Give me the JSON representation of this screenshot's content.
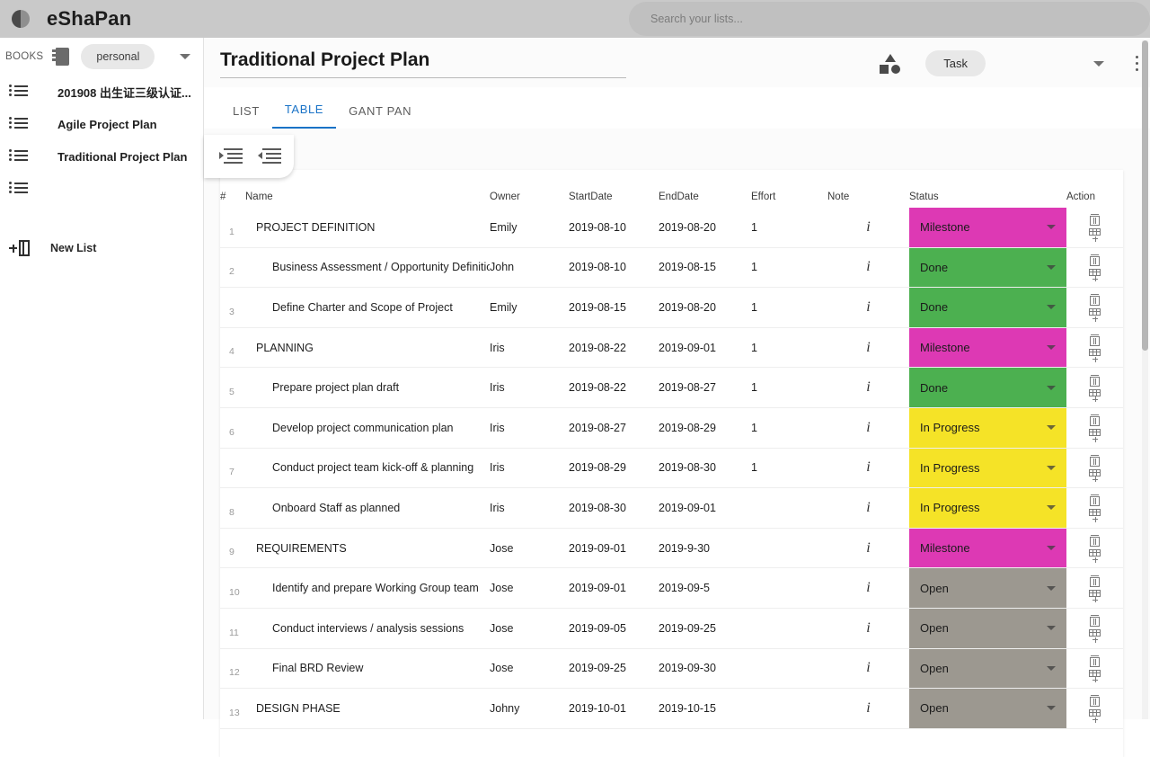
{
  "app": {
    "brand": "eShaPan",
    "logo_icon": "split-circle-icon"
  },
  "search": {
    "placeholder": "Search your lists...",
    "value": ""
  },
  "sidebar": {
    "section_label": "BOOKS",
    "book_icon": "notebook-icon",
    "book_chip": "personal",
    "book_caret": "chevron-down-icon",
    "items": [
      {
        "label": "201908 出生证三级认证...",
        "icon": "list-icon"
      },
      {
        "label": "Agile Project Plan",
        "icon": "list-icon"
      },
      {
        "label": "Traditional Project Plan",
        "icon": "list-icon"
      },
      {
        "label": "",
        "icon": "list-icon"
      }
    ],
    "new_list": {
      "label": "New List",
      "icon": "add-list-icon"
    }
  },
  "header": {
    "title": "Traditional Project Plan",
    "shapes_icon": "shapes-icon",
    "task_chip": "Task",
    "caret_icon": "chevron-down-icon",
    "menu_icon": "more-vertical-icon"
  },
  "tabs": [
    {
      "label": "LIST",
      "active": false
    },
    {
      "label": "TABLE",
      "active": true
    },
    {
      "label": "GANT PAN",
      "active": false
    }
  ],
  "indent_toolbar": {
    "increase": "indent-increase-icon",
    "decrease": "indent-decrease-icon"
  },
  "table": {
    "columns": {
      "num": "#",
      "name": "Name",
      "owner": "Owner",
      "startdate": "StartDate",
      "enddate": "EndDate",
      "effort": "Effort",
      "note": "Note",
      "status": "Status",
      "action": "Action"
    },
    "status_colors": {
      "Milestone": "#DD39B4",
      "Done": "#4CB050",
      "In Progress": "#F5E327",
      "Open": "#9C9890"
    },
    "rows": [
      {
        "num": "1",
        "name": "PROJECT DEFINITION",
        "level": 0,
        "owner": "Emily",
        "start": "2019-08-10",
        "end": "2019-08-20",
        "effort": "1",
        "note": "i",
        "status": "Milestone"
      },
      {
        "num": "2",
        "name": "Business Assessment / Opportunity Definition",
        "level": 1,
        "owner": "John",
        "start": "2019-08-10",
        "end": "2019-08-15",
        "effort": "1",
        "note": "i",
        "status": "Done"
      },
      {
        "num": "3",
        "name": "Define Charter and Scope of Project",
        "level": 1,
        "owner": "Emily",
        "start": "2019-08-15",
        "end": "2019-08-20",
        "effort": "1",
        "note": "i",
        "status": "Done"
      },
      {
        "num": "4",
        "name": "PLANNING",
        "level": 0,
        "owner": "Iris",
        "start": "2019-08-22",
        "end": "2019-09-01",
        "effort": "1",
        "note": "i",
        "status": "Milestone"
      },
      {
        "num": "5",
        "name": "Prepare project plan draft",
        "level": 1,
        "owner": "Iris",
        "start": "2019-08-22",
        "end": "2019-08-27",
        "effort": "1",
        "note": "i",
        "status": "Done"
      },
      {
        "num": "6",
        "name": "Develop project communication plan",
        "level": 1,
        "owner": "Iris",
        "start": "2019-08-27",
        "end": "2019-08-29",
        "effort": "1",
        "note": "i",
        "status": "In Progress"
      },
      {
        "num": "7",
        "name": "Conduct project team kick-off & planning",
        "level": 1,
        "owner": "Iris",
        "start": "2019-08-29",
        "end": "2019-08-30",
        "effort": "1",
        "note": "i",
        "status": "In Progress"
      },
      {
        "num": "8",
        "name": "Onboard Staff as planned",
        "level": 1,
        "owner": "Iris",
        "start": "2019-08-30",
        "end": "2019-09-01",
        "effort": "",
        "note": "i",
        "status": "In Progress"
      },
      {
        "num": "9",
        "name": "REQUIREMENTS",
        "level": 0,
        "owner": "Jose",
        "start": "2019-09-01",
        "end": "2019-9-30",
        "effort": "",
        "note": "i",
        "status": "Milestone"
      },
      {
        "num": "10",
        "name": "Identify and prepare Working Group team",
        "level": 1,
        "owner": "Jose",
        "start": "2019-09-01",
        "end": "2019-09-5",
        "effort": "",
        "note": "i",
        "status": "Open"
      },
      {
        "num": "11",
        "name": "Conduct interviews / analysis sessions",
        "level": 1,
        "owner": "Jose",
        "start": "2019-09-05",
        "end": "2019-09-25",
        "effort": "",
        "note": "i",
        "status": "Open"
      },
      {
        "num": "12",
        "name": "Final BRD Review",
        "level": 1,
        "owner": "Jose",
        "start": "2019-09-25",
        "end": "2019-09-30",
        "effort": "",
        "note": "i",
        "status": "Open"
      },
      {
        "num": "13",
        "name": "DESIGN PHASE",
        "level": 0,
        "owner": "Johny",
        "start": "2019-10-01",
        "end": "2019-10-15",
        "effort": "",
        "note": "i",
        "status": "Open"
      }
    ],
    "action_icons": {
      "delete": "trash-icon",
      "add_row": "add-row-icon"
    }
  }
}
